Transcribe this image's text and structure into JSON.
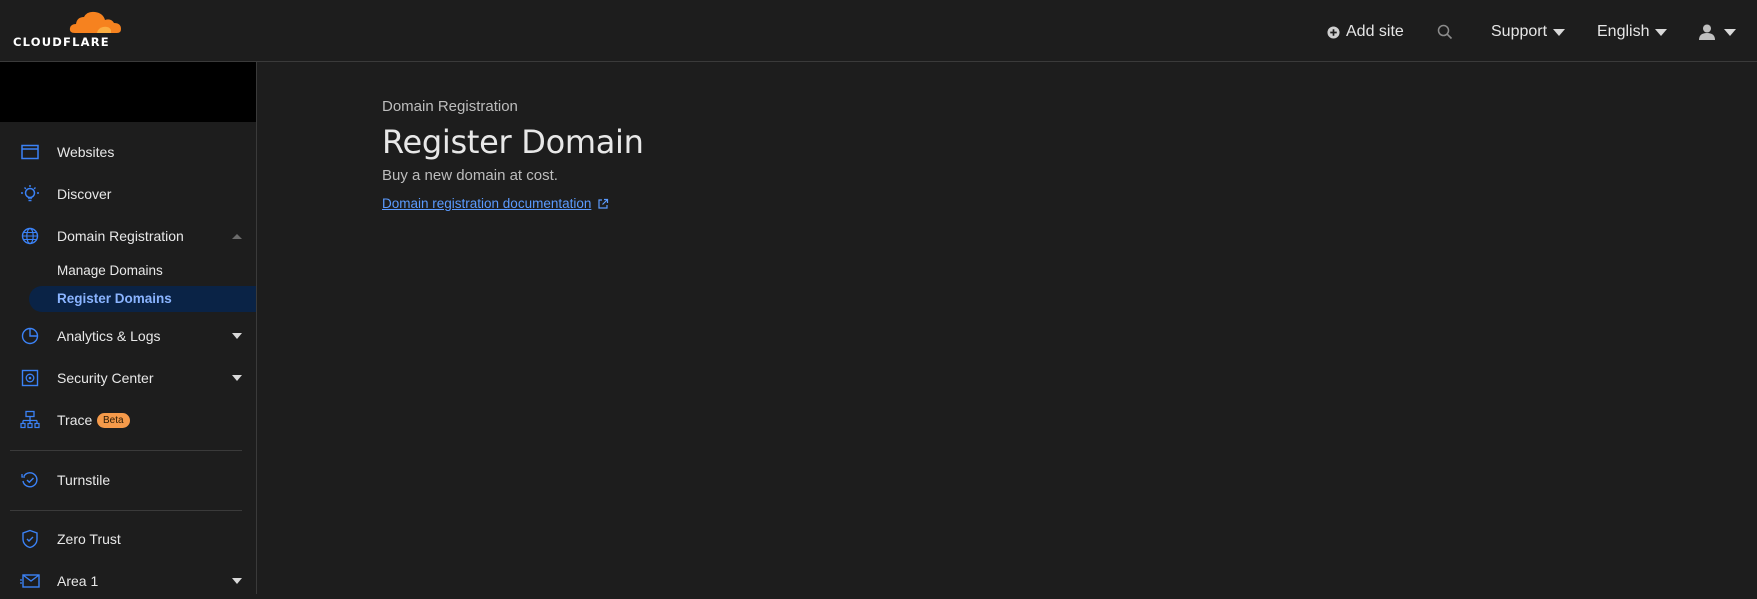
{
  "brand": {
    "logo_text": "CLOUDFLARE",
    "logo_color": "#f6821f"
  },
  "topbar": {
    "add_site": "Add site",
    "support": "Support",
    "language": "English"
  },
  "sidebar": {
    "items": [
      {
        "label": "Websites",
        "icon": "browser-window-icon"
      },
      {
        "label": "Discover",
        "icon": "lightbulb-icon"
      },
      {
        "label": "Domain Registration",
        "icon": "globe-icon",
        "expanded": true,
        "children": [
          {
            "label": "Manage Domains"
          },
          {
            "label": "Register Domains",
            "active": true
          }
        ]
      },
      {
        "label": "Analytics & Logs",
        "icon": "pie-chart-icon"
      },
      {
        "label": "Security Center",
        "icon": "security-shield-icon"
      },
      {
        "label": "Trace",
        "icon": "trace-network-icon",
        "badge": "Beta"
      },
      {
        "label": "Turnstile",
        "icon": "turnstile-check-icon"
      },
      {
        "label": "Zero Trust",
        "icon": "zero-trust-shield-icon"
      },
      {
        "label": "Area 1",
        "icon": "mail-icon"
      }
    ]
  },
  "main": {
    "breadcrumb": "Domain Registration",
    "title": "Register Domain",
    "subtitle": "Buy a new domain at cost.",
    "doc_link": "Domain registration documentation"
  },
  "colors": {
    "accent": "#3b82f6",
    "active_bg": "#0a2346",
    "badge": "#f59a4a"
  }
}
